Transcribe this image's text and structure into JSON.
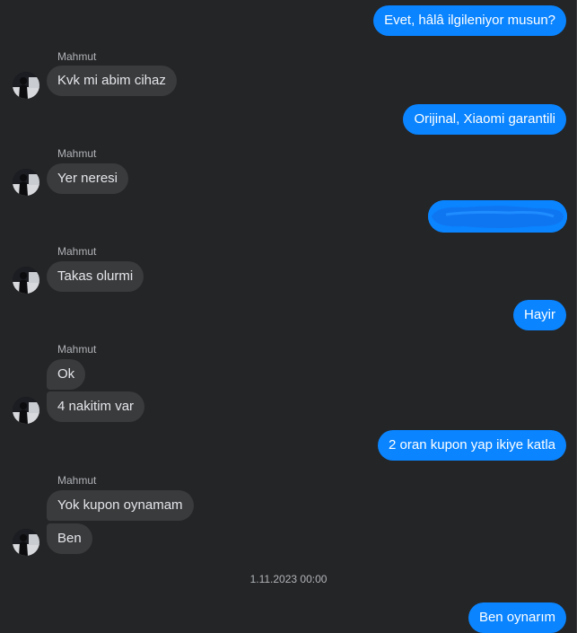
{
  "conversation": {
    "contact_name": "Mahmut",
    "timestamp": "1.11.2023 00:00",
    "messages": [
      {
        "id": "m1",
        "direction": "out",
        "text": "Evet, hâlâ ilgileniyor musun?"
      },
      {
        "id": "m2",
        "direction": "in",
        "sender": "Mahmut",
        "text": "Kvk mi abim cihaz"
      },
      {
        "id": "m3",
        "direction": "out",
        "text": "Orijinal, Xiaomi garantili"
      },
      {
        "id": "m4",
        "direction": "in",
        "sender": "Mahmut",
        "text": "Yer neresi"
      },
      {
        "id": "m5",
        "direction": "out",
        "text": "",
        "redacted": true
      },
      {
        "id": "m6",
        "direction": "in",
        "sender": "Mahmut",
        "text": "Takas olurmi"
      },
      {
        "id": "m7",
        "direction": "out",
        "text": "Hayir"
      },
      {
        "id": "m8",
        "direction": "in",
        "sender": "Mahmut",
        "text": "Ok"
      },
      {
        "id": "m9",
        "direction": "in",
        "text": "4 nakitim var"
      },
      {
        "id": "m10",
        "direction": "out",
        "text": "2 oran kupon yap ikiye katla"
      },
      {
        "id": "m11",
        "direction": "in",
        "sender": "Mahmut",
        "text": "Yok kupon oynamam"
      },
      {
        "id": "m12",
        "direction": "in",
        "text": "Ben"
      },
      {
        "id": "m13",
        "direction": "out",
        "text": "Ben oynarım"
      }
    ]
  },
  "icons": {
    "avatar": "user-avatar-icon"
  },
  "colors": {
    "background": "#242526",
    "outgoing_bubble": "#0a84ff",
    "incoming_bubble": "#3a3b3c",
    "muted_text": "#b0b3b8"
  }
}
